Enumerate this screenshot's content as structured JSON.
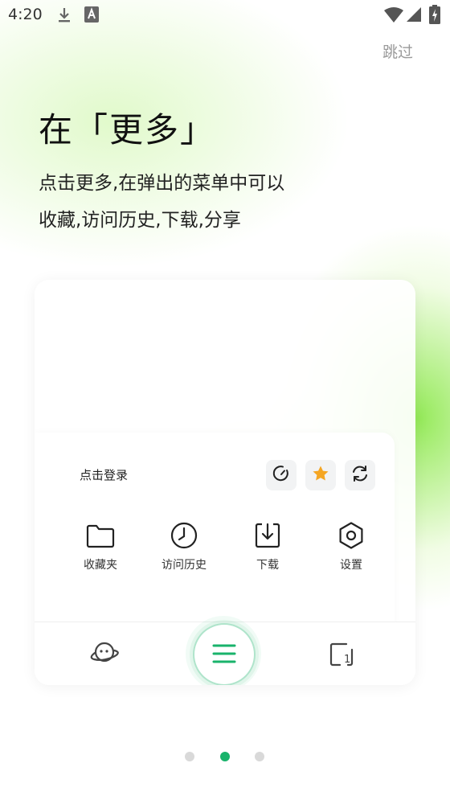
{
  "status_bar": {
    "time": "4:20"
  },
  "skip_label": "跳过",
  "title": "在「更多」",
  "description_lines": [
    "点击更多,在弹出的菜单中可以",
    "收藏,访问历史,下载,分享"
  ],
  "preview": {
    "login_label": "点击登录",
    "quick_actions": [
      "timer-icon",
      "star-icon",
      "refresh-icon"
    ],
    "menu_items": [
      {
        "label": "收藏夹",
        "icon": "folder-icon"
      },
      {
        "label": "访问历史",
        "icon": "clock-icon"
      },
      {
        "label": "下载",
        "icon": "download-icon"
      },
      {
        "label": "设置",
        "icon": "settings-icon"
      }
    ],
    "bottom_nav": [
      "planet-icon",
      "menu-icon",
      "tabs-icon"
    ],
    "tab_count": "1"
  },
  "pagination": {
    "total": 3,
    "active_index": 1
  },
  "colors": {
    "accent": "#19b36b",
    "star": "#f5a623"
  }
}
